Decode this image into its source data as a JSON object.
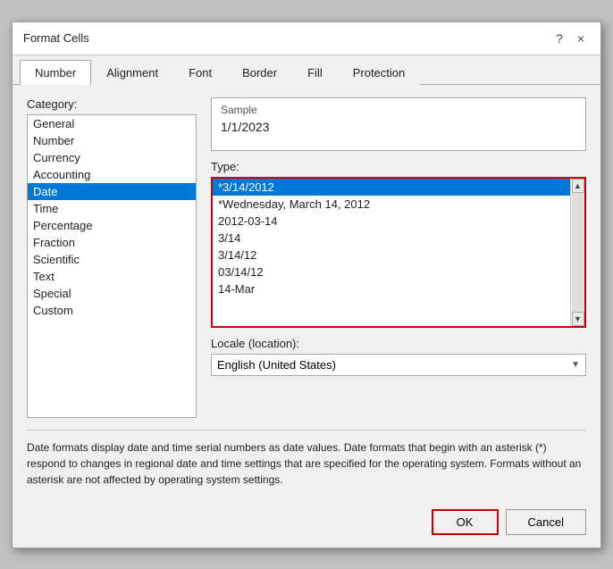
{
  "dialog": {
    "title": "Format Cells",
    "help_icon": "?",
    "close_icon": "×"
  },
  "tabs": [
    {
      "label": "Number",
      "active": true
    },
    {
      "label": "Alignment",
      "active": false
    },
    {
      "label": "Font",
      "active": false
    },
    {
      "label": "Border",
      "active": false
    },
    {
      "label": "Fill",
      "active": false
    },
    {
      "label": "Protection",
      "active": false
    }
  ],
  "category": {
    "label": "Category:",
    "items": [
      {
        "label": "General",
        "selected": false
      },
      {
        "label": "Number",
        "selected": false
      },
      {
        "label": "Currency",
        "selected": false
      },
      {
        "label": "Accounting",
        "selected": false
      },
      {
        "label": "Date",
        "selected": true
      },
      {
        "label": "Time",
        "selected": false
      },
      {
        "label": "Percentage",
        "selected": false
      },
      {
        "label": "Fraction",
        "selected": false
      },
      {
        "label": "Scientific",
        "selected": false
      },
      {
        "label": "Text",
        "selected": false
      },
      {
        "label": "Special",
        "selected": false
      },
      {
        "label": "Custom",
        "selected": false
      }
    ]
  },
  "sample": {
    "label": "Sample",
    "value": "1/1/2023"
  },
  "type": {
    "label": "Type:",
    "items": [
      {
        "label": "*3/14/2012",
        "selected": true
      },
      {
        "label": "*Wednesday, March 14, 2012",
        "selected": false
      },
      {
        "label": "2012-03-14",
        "selected": false
      },
      {
        "label": "3/14",
        "selected": false
      },
      {
        "label": "3/14/12",
        "selected": false
      },
      {
        "label": "03/14/12",
        "selected": false
      },
      {
        "label": "14-Mar",
        "selected": false
      }
    ]
  },
  "locale": {
    "label": "Locale (location):",
    "value": "English (United States)"
  },
  "description": "Date formats display date and time serial numbers as date values.  Date formats that begin with an asterisk (*) respond to changes in regional date and time settings that are specified for the operating system. Formats without an asterisk are not affected by operating system settings.",
  "buttons": {
    "ok_label": "OK",
    "cancel_label": "Cancel"
  }
}
